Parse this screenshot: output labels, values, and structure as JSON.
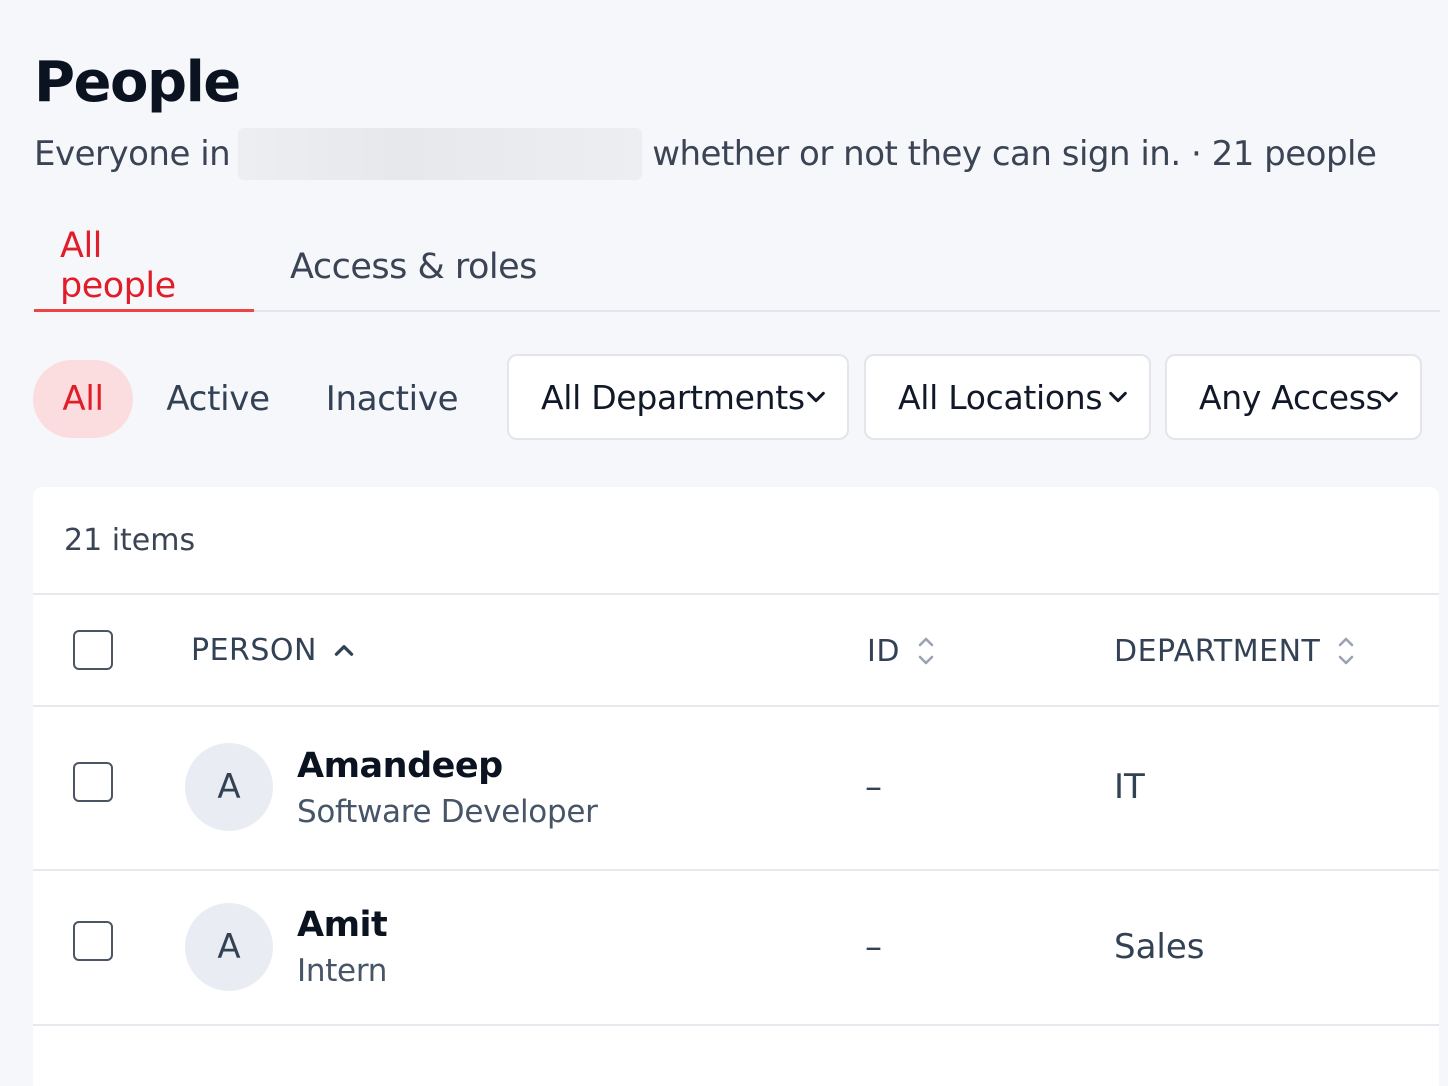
{
  "page": {
    "title": "People",
    "subtitle_prefix": "Everyone in",
    "subtitle_suffix": "whether or not they can sign in. · 21 people"
  },
  "tabs": [
    {
      "label": "All people",
      "active": true
    },
    {
      "label": "Access & roles",
      "active": false
    }
  ],
  "status_filter": {
    "all": "All",
    "active": "Active",
    "inactive": "Inactive",
    "selected": "All"
  },
  "dropdowns": {
    "department": "All Departments",
    "location": "All Locations",
    "access": "Any Access"
  },
  "table": {
    "count_label": "21 items",
    "columns": {
      "person": "PERSON",
      "id": "ID",
      "department": "DEPARTMENT"
    },
    "sort": {
      "column": "PERSON",
      "direction": "ascending"
    },
    "rows": [
      {
        "initial": "A",
        "name": "Amandeep",
        "role": "Software Developer",
        "id": "–",
        "department": "IT"
      },
      {
        "initial": "A",
        "name": "Amit",
        "role": "Intern",
        "id": "–",
        "department": "Sales"
      }
    ]
  },
  "colors": {
    "accent": "#e11d2a",
    "accent_bg": "#fbdcdf",
    "background": "#f6f7fa"
  }
}
